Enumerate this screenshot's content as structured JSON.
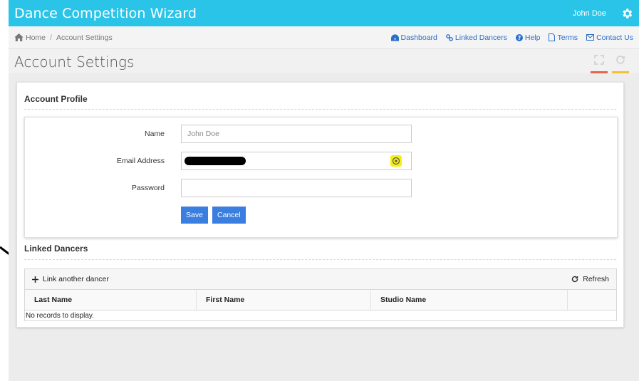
{
  "app": {
    "title": "Dance Competition Wizard",
    "user": "John Doe"
  },
  "breadcrumb": {
    "home": "Home",
    "separator": "/",
    "current": "Account Settings"
  },
  "nav_links": [
    {
      "label": "Dashboard",
      "icon": "dashboard-icon"
    },
    {
      "label": "Linked Dancers",
      "icon": "link-icon"
    },
    {
      "label": "Help",
      "icon": "help-icon"
    },
    {
      "label": "Terms",
      "icon": "document-icon"
    },
    {
      "label": "Contact Us",
      "icon": "mail-icon"
    }
  ],
  "page": {
    "title": "Account Settings"
  },
  "profile": {
    "heading": "Account Profile",
    "name_label": "Name",
    "name_value": "John Doe",
    "email_label": "Email Address",
    "password_label": "Password",
    "save_label": "Save",
    "cancel_label": "Cancel"
  },
  "linked": {
    "heading": "Linked Dancers",
    "add_label": "Link another dancer",
    "refresh_label": "Refresh",
    "columns": [
      "Last Name",
      "First Name",
      "Studio Name",
      ""
    ],
    "empty_text": "No records to display."
  },
  "colors": {
    "header_bg": "#29c4e8",
    "accent_blue": "#3a7fe0",
    "tool_expand_bar": "#e8644a",
    "tool_refresh_bar": "#f2c230",
    "picker_bg": "#f7ee14"
  }
}
